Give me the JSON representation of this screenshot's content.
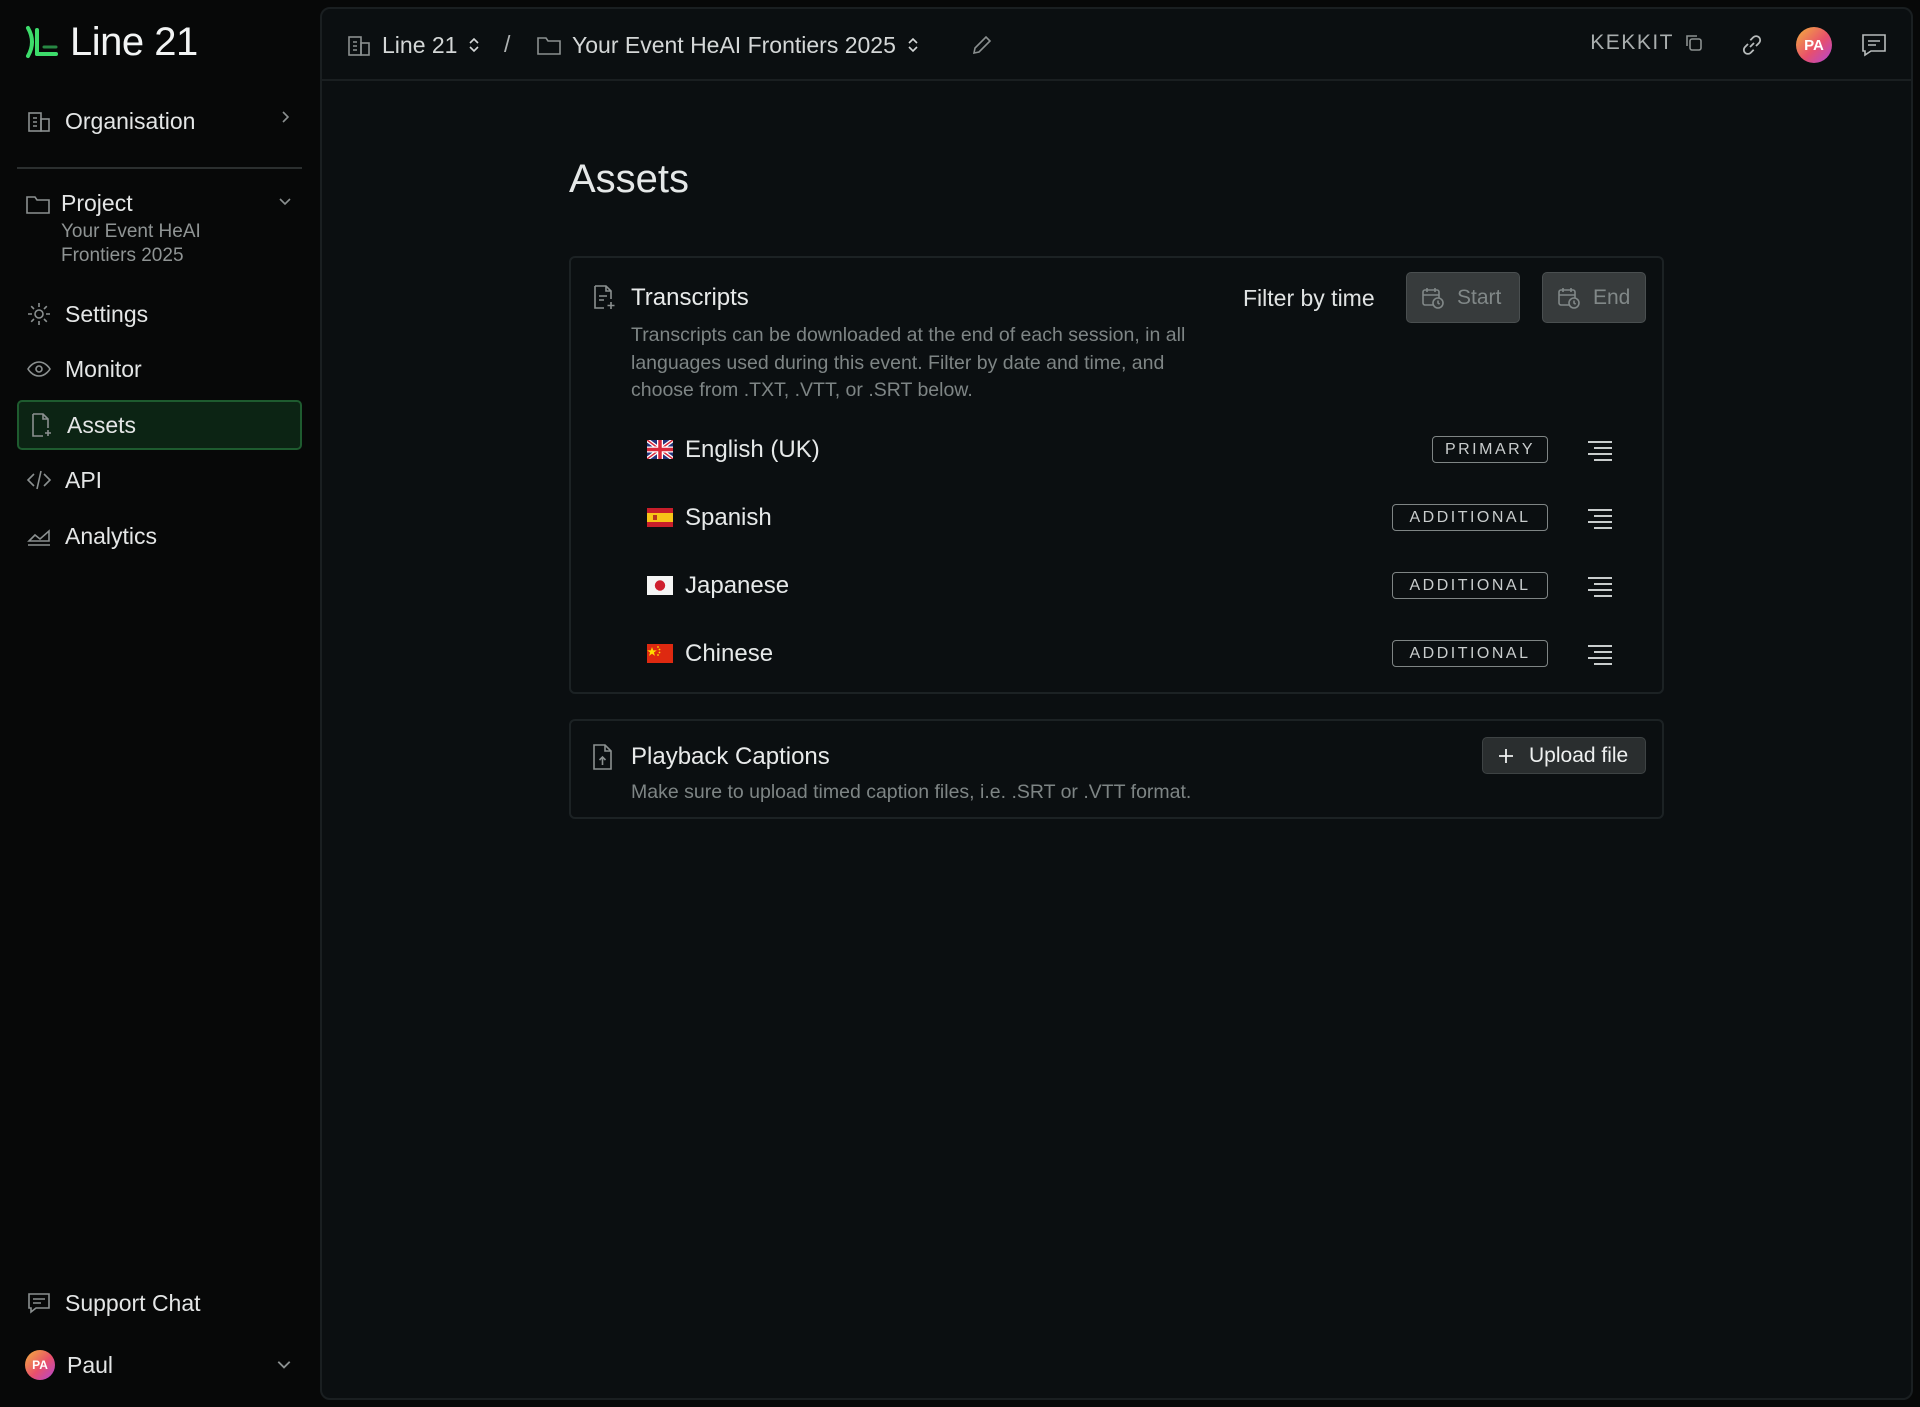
{
  "app": {
    "name": "Line 21",
    "accent": "#3ddc6b"
  },
  "sidebar": {
    "organisation_label": "Organisation",
    "project": {
      "label": "Project",
      "name": "Your Event HeAI Frontiers 2025"
    },
    "items": [
      {
        "label": "Settings",
        "icon": "gear-icon"
      },
      {
        "label": "Monitor",
        "icon": "eye-icon"
      },
      {
        "label": "Assets",
        "icon": "file-sparkle-icon",
        "active": true
      },
      {
        "label": "API",
        "icon": "code-icon"
      },
      {
        "label": "Analytics",
        "icon": "chart-area-icon"
      }
    ],
    "support_chat": "Support Chat",
    "user": {
      "name": "Paul",
      "initials": "PA"
    }
  },
  "topbar": {
    "org_crumb": "Line 21",
    "separator": "/",
    "project_crumb": "Your Event HeAI Frontiers 2025",
    "join_code": "KEKKIT",
    "avatar_initials": "PA"
  },
  "page": {
    "title": "Assets"
  },
  "transcripts": {
    "title": "Transcripts",
    "description": "Transcripts can be downloaded at the end of each session, in all languages used during this event. Filter by date and time, and choose from .TXT, .VTT, or .SRT below.",
    "filter_label": "Filter by time",
    "start_label": "Start",
    "end_label": "End",
    "languages": [
      {
        "name": "English (UK)",
        "badge": "PRIMARY",
        "flag": "uk-flag"
      },
      {
        "name": "Spanish",
        "badge": "ADDITIONAL",
        "flag": "spain-flag"
      },
      {
        "name": "Japanese",
        "badge": "ADDITIONAL",
        "flag": "japan-flag"
      },
      {
        "name": "Chinese",
        "badge": "ADDITIONAL",
        "flag": "china-flag"
      }
    ]
  },
  "captions": {
    "title": "Playback Captions",
    "description": "Make sure to upload timed caption files, i.e. .SRT or .VTT format.",
    "upload_label": "Upload file"
  }
}
